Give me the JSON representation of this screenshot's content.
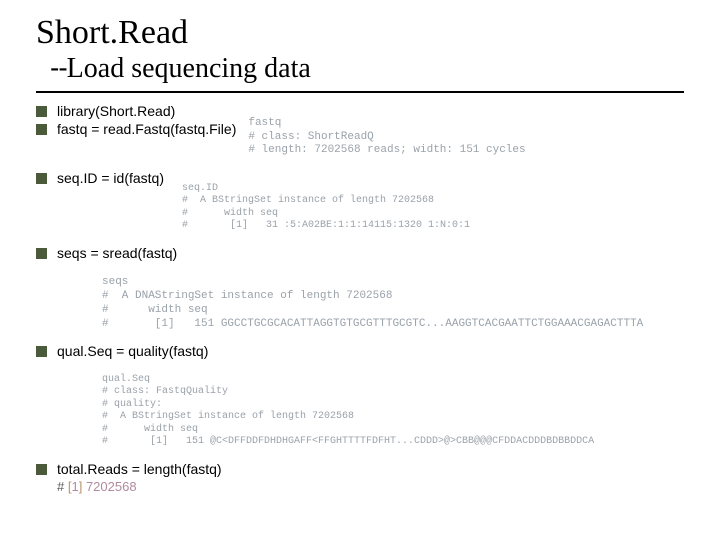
{
  "title": {
    "main": "Short.Read",
    "sub_prefix": "--",
    "sub": "Load sequencing data"
  },
  "items": {
    "lib": "library(Short.Read)",
    "read": "fastq = read.Fastq(fastq.File)",
    "seqid": "seq.ID = id(fastq)",
    "seqs": "seqs = sread(fastq)",
    "qual": "qual.Seq = quality(fastq)",
    "total": "total.Reads = length(fastq)"
  },
  "out": {
    "fastq": {
      "l1": "fastq",
      "l2": "# class: ShortReadQ",
      "l3": "# length: 7202568 reads; width: 151 cycles"
    },
    "seqid": {
      "l1": "seq.ID",
      "l2": "#  A BStringSet instance of length 7202568",
      "l3": "#      width seq",
      "l4": "#       [1]   31 :5:A02BE:1:1:14115:1320 1:N:0:1"
    },
    "seqs": {
      "l1": "seqs",
      "l2": "#  A DNAStringSet instance of length 7202568",
      "l3": "#      width seq",
      "l4": "#       [1]   151 GGCCTGCGCACATTAGGTGTGCGTTTGCGTC...AAGGTCACGAATTCTGGAAACGAGACTTTA"
    },
    "qual": {
      "l1": "qual.Seq",
      "l2": "# class: FastqQuality",
      "l3": "# quality:",
      "l4": "#  A BStringSet instance of length 7202568",
      "l5": "#      width seq",
      "l6": "#       [1]   151 @C<DFFDDFDHDHGAFF<FFGHTTTTFDFHT...CDDD>@>CBB@@@CFDDACDDDBDBBDDCA"
    },
    "total": {
      "pre": "# ",
      "br_open": "[",
      "idx": "1",
      "br_close": "]",
      "val": " 7202568"
    }
  }
}
